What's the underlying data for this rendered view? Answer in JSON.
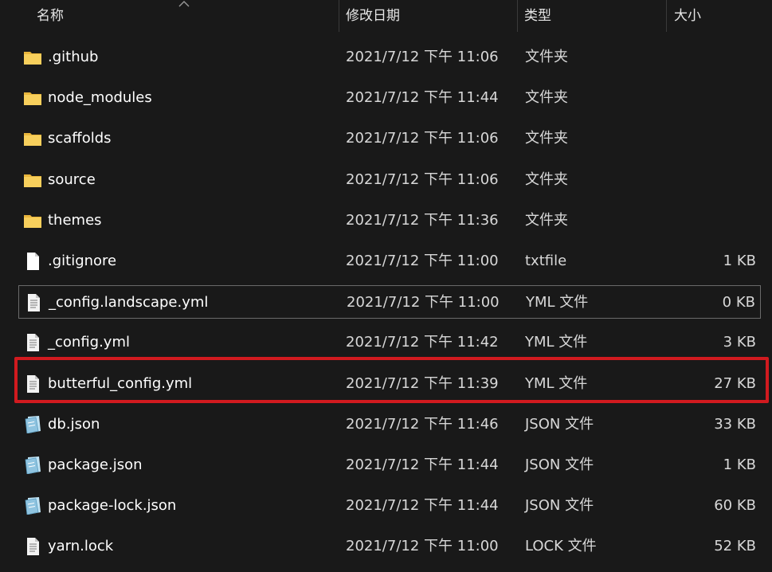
{
  "header": {
    "name_label": "名称",
    "date_label": "修改日期",
    "type_label": "类型",
    "size_label": "大小"
  },
  "files": [
    {
      "name": ".github",
      "date": "2021/7/12 下午 11:06",
      "type": "文件夹",
      "size": "",
      "icon": "folder-icon"
    },
    {
      "name": "node_modules",
      "date": "2021/7/12 下午 11:44",
      "type": "文件夹",
      "size": "",
      "icon": "folder-icon"
    },
    {
      "name": "scaffolds",
      "date": "2021/7/12 下午 11:06",
      "type": "文件夹",
      "size": "",
      "icon": "folder-icon"
    },
    {
      "name": "source",
      "date": "2021/7/12 下午 11:06",
      "type": "文件夹",
      "size": "",
      "icon": "folder-icon"
    },
    {
      "name": "themes",
      "date": "2021/7/12 下午 11:36",
      "type": "文件夹",
      "size": "",
      "icon": "folder-icon"
    },
    {
      "name": ".gitignore",
      "date": "2021/7/12 下午 11:00",
      "type": "txtfile",
      "size": "1 KB",
      "icon": "blank-file-icon"
    },
    {
      "name": "_config.landscape.yml",
      "date": "2021/7/12 下午 11:00",
      "type": "YML 文件",
      "size": "0 KB",
      "icon": "text-file-icon"
    },
    {
      "name": "_config.yml",
      "date": "2021/7/12 下午 11:42",
      "type": "YML 文件",
      "size": "3 KB",
      "icon": "text-file-icon"
    },
    {
      "name": "butterful_config.yml",
      "date": "2021/7/12 下午 11:39",
      "type": "YML 文件",
      "size": "27 KB",
      "icon": "text-file-icon"
    },
    {
      "name": "db.json",
      "date": "2021/7/12 下午 11:46",
      "type": "JSON 文件",
      "size": "33 KB",
      "icon": "json-file-icon"
    },
    {
      "name": "package.json",
      "date": "2021/7/12 下午 11:44",
      "type": "JSON 文件",
      "size": "1 KB",
      "icon": "json-file-icon"
    },
    {
      "name": "package-lock.json",
      "date": "2021/7/12 下午 11:44",
      "type": "JSON 文件",
      "size": "60 KB",
      "icon": "json-file-icon"
    },
    {
      "name": "yarn.lock",
      "date": "2021/7/12 下午 11:00",
      "type": "LOCK 文件",
      "size": "52 KB",
      "icon": "text-file-icon"
    }
  ],
  "selected_file": "_config.landscape.yml",
  "highlighted_file": "butterful_config.yml",
  "colors": {
    "background": "#191919",
    "highlight": "#d11a1f",
    "folder": "#f0c24f"
  }
}
